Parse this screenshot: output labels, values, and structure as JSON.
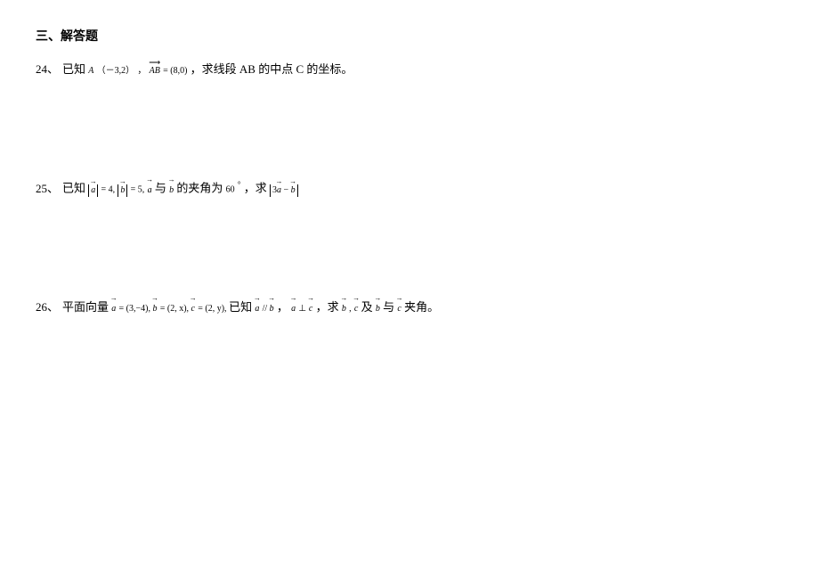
{
  "section_title": "三、解答题",
  "problems": [
    {
      "number": "24、",
      "prefix": "已知",
      "math1_label": "A",
      "math1_coords": "（－3,2）",
      "math1_sep": "，",
      "math1_vec": "AB",
      "math1_eq": " = (8,0)",
      "text_mid": "，求线段 AB 的中点 C 的坐标。"
    },
    {
      "number": "25、",
      "prefix": "已知",
      "abs_a": "a",
      "eq_a": " = 4,",
      "abs_b": "b",
      "eq_b": " = 5,",
      "vec_a": "a",
      "text_with": "与",
      "vec_b": "b",
      "text_angle": "的夹角为",
      "angle_val": "60",
      "angle_deg": "°",
      "text_comma": "，求",
      "abs_expr_3a": "3",
      "abs_expr_a": "a",
      "abs_expr_minus": " − ",
      "abs_expr_b": "b"
    },
    {
      "number": "26、",
      "prefix": "平面向量",
      "vec_a": "a",
      "eq_a": " = (3,−4), ",
      "vec_b": "b",
      "eq_b": " = (2, x), ",
      "vec_c": "c",
      "eq_c": " = (2, y), ",
      "text_known": "已知",
      "vec_a2": "a",
      "parallel": " // ",
      "vec_b2": "b",
      "comma1": "，",
      "vec_a3": "a",
      "perp": " ⊥ ",
      "vec_c2": "c",
      "comma2": "，求",
      "vec_b3": "b",
      "dot": ",",
      "vec_c3": "c",
      "text_and": " 及",
      "vec_b4": "b",
      "text_with2": "与",
      "vec_c4": "c",
      "text_angle2": "夹角。"
    }
  ]
}
